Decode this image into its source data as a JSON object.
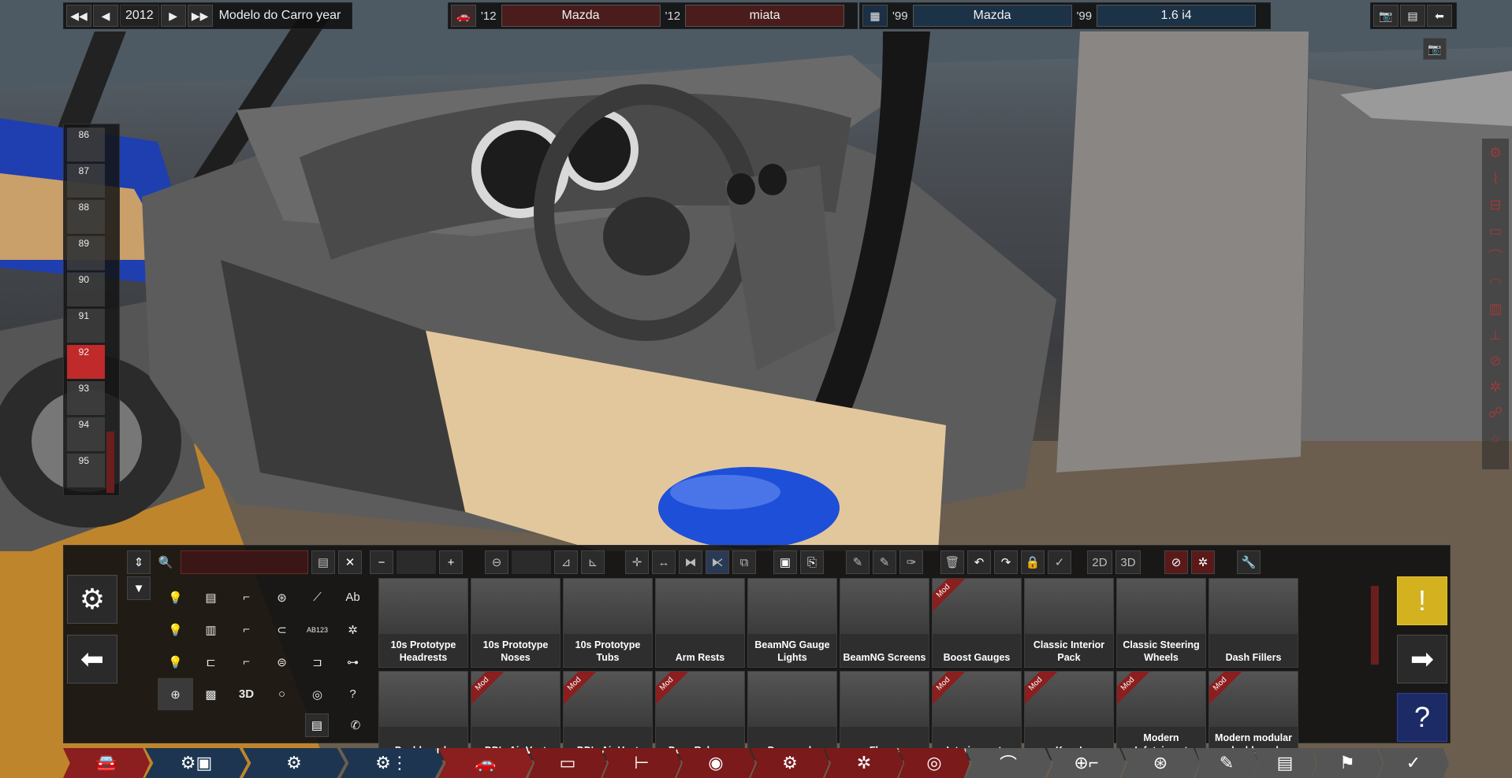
{
  "topbar": {
    "year": "2012",
    "title": "Modelo do Carro year",
    "car_year_left": "'12",
    "car_make": "Mazda",
    "car_year_mid": "'12",
    "car_model": "miata",
    "donor_year_left": "'99",
    "donor_make": "Mazda",
    "donor_year_mid": "'99",
    "donor_engine": "1.6 i4"
  },
  "slots": [
    "86",
    "87",
    "88",
    "89",
    "90",
    "91",
    "92",
    "93",
    "94",
    "95"
  ],
  "active_slot": "92",
  "toolbar": {
    "view_2d": "2D",
    "view_3d": "3D"
  },
  "categories": [
    "",
    "",
    "",
    "",
    "",
    "Ab",
    "",
    "",
    "",
    "",
    "AB123",
    "",
    "",
    "",
    "",
    "",
    "",
    "",
    "",
    "",
    "3D",
    "",
    "",
    ""
  ],
  "parts": [
    {
      "label": "10s Prototype Headrests",
      "mod": false
    },
    {
      "label": "10s Prototype Noses",
      "mod": false
    },
    {
      "label": "10s Prototype Tubs",
      "mod": false
    },
    {
      "label": "Arm Rests",
      "mod": false
    },
    {
      "label": "BeamNG Gauge Lights",
      "mod": false
    },
    {
      "label": "BeamNG Screens",
      "mod": false
    },
    {
      "label": "Boost Gauges",
      "mod": true
    },
    {
      "label": "Classic Interior Pack",
      "mod": false
    },
    {
      "label": "Classic Steering Wheels",
      "mod": false
    },
    {
      "label": "Dash Fillers",
      "mod": false
    },
    {
      "label": "Dashboards",
      "mod": false
    },
    {
      "label": "DD's Air Vent",
      "mod": true
    },
    {
      "label": "DD's Air Vent",
      "mod": true
    },
    {
      "label": "Door Release",
      "mod": true
    },
    {
      "label": "Doorcards",
      "mod": false
    },
    {
      "label": "Floors",
      "mod": false
    },
    {
      "label": "Interior parts",
      "mod": true
    },
    {
      "label": "Keys!",
      "mod": true
    },
    {
      "label": "Modern Infotaiment",
      "mod": true
    },
    {
      "label": "Modern modular dashboard",
      "mod": true
    }
  ],
  "mod_badge": "Mod",
  "colors": {
    "accent_red": "#8b1e1e",
    "field_red": "#4a1c1c",
    "field_blue": "#1c3247",
    "warning_yellow": "#d4b11f",
    "help_blue": "#1c2a66"
  }
}
